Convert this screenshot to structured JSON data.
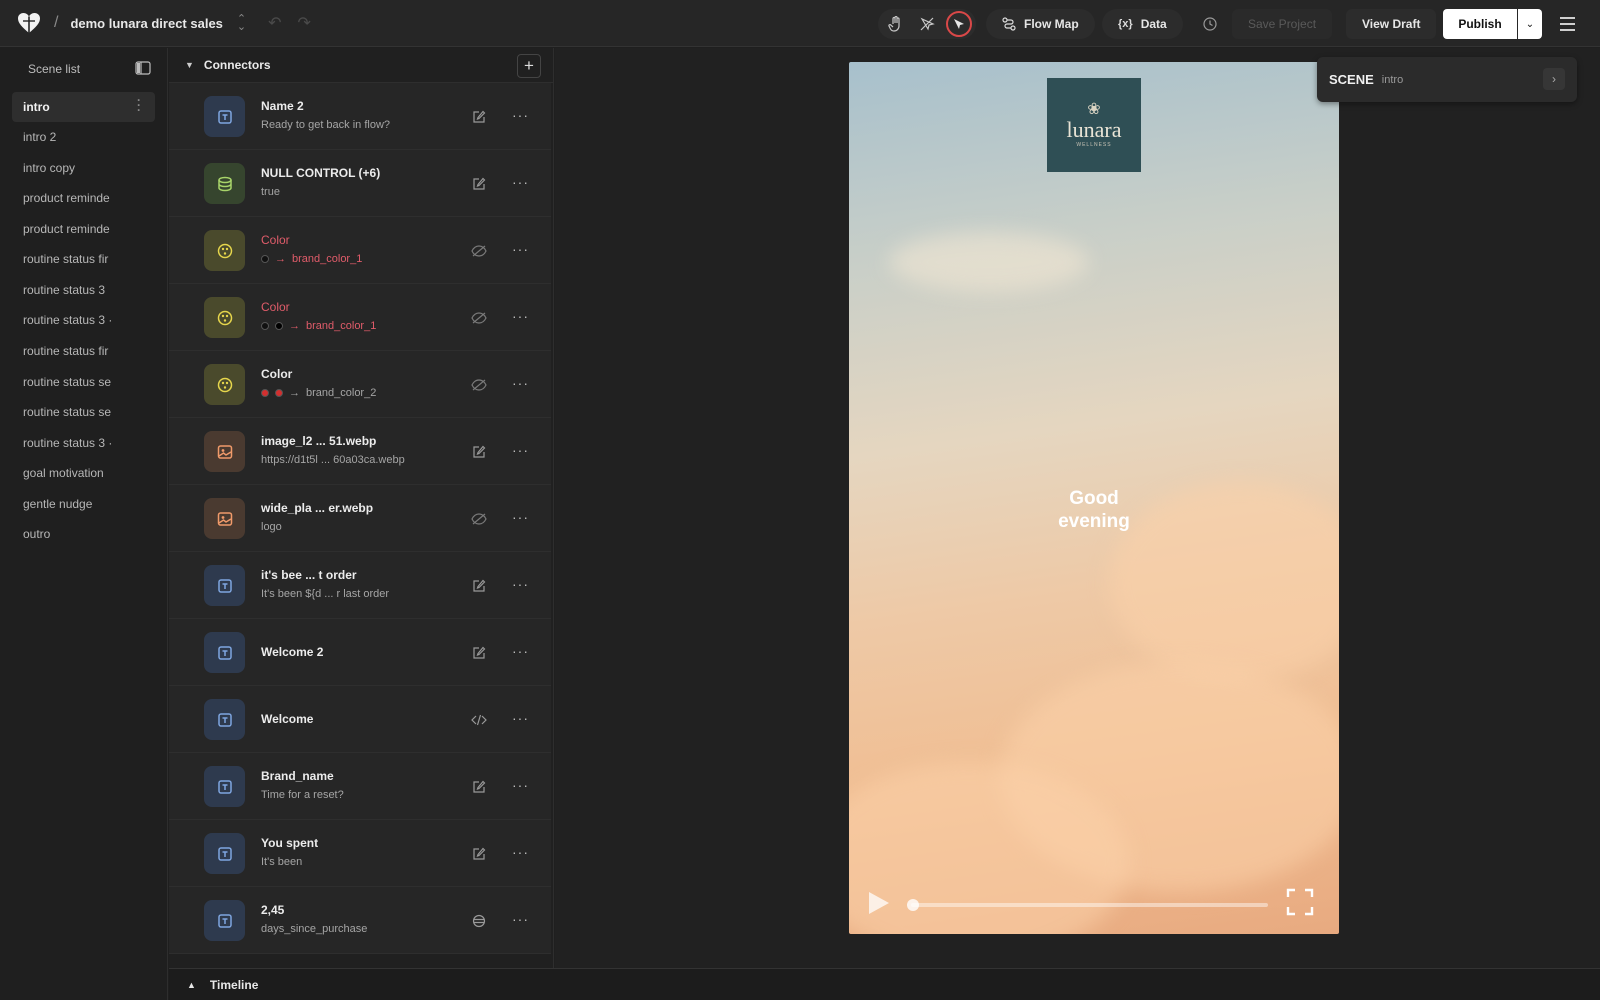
{
  "topbar": {
    "project_name": "demo lunara direct sales",
    "flow_map_label": "Flow Map",
    "data_label": "Data",
    "save_label": "Save Project",
    "view_draft_label": "View Draft",
    "publish_label": "Publish"
  },
  "scene_list": {
    "title": "Scene list",
    "items": [
      {
        "label": "intro",
        "active": true
      },
      {
        "label": "intro 2"
      },
      {
        "label": "intro copy"
      },
      {
        "label": "product reminde"
      },
      {
        "label": "product reminde"
      },
      {
        "label": "routine status fir"
      },
      {
        "label": "routine status 3"
      },
      {
        "label": "routine status 3 ·"
      },
      {
        "label": "routine status fir"
      },
      {
        "label": "routine status se"
      },
      {
        "label": "routine status se"
      },
      {
        "label": "routine status 3 ·"
      },
      {
        "label": "goal motivation"
      },
      {
        "label": "gentle nudge"
      },
      {
        "label": "outro"
      }
    ]
  },
  "connectors": {
    "title": "Connectors",
    "rows": [
      {
        "title": "Name 2",
        "subtitle": "Ready to get back in flow?",
        "icon": "text-connector-icon",
        "action": "edit-icon"
      },
      {
        "title": "NULL CONTROL (+6)",
        "subtitle": "true",
        "icon": "database-icon",
        "action": "edit-icon"
      },
      {
        "title": "Color",
        "subtitle": "brand_color_1",
        "icon": "palette-icon",
        "action": "hidden-icon",
        "red": true
      },
      {
        "title": "Color",
        "subtitle": "brand_color_1",
        "icon": "palette-icon",
        "action": "hidden-icon",
        "red": true
      },
      {
        "title": "Color",
        "subtitle": "brand_color_2",
        "icon": "palette-icon",
        "action": "hidden-icon"
      },
      {
        "title": "image_l2 ... 51.webp",
        "subtitle": "https://d1t5l ... 60a03ca.webp",
        "icon": "image-icon",
        "action": "edit-icon"
      },
      {
        "title": "wide_pla ... er.webp",
        "subtitle": "logo",
        "icon": "image-icon",
        "action": "hidden-icon"
      },
      {
        "title": "it's bee ... t order",
        "subtitle": "It's been ${d ... r last order",
        "icon": "text-connector-icon",
        "action": "edit-icon"
      },
      {
        "title": "Welcome 2",
        "subtitle": "",
        "icon": "text-connector-icon",
        "action": "edit-icon"
      },
      {
        "title": "Welcome",
        "subtitle": "",
        "icon": "text-connector-icon",
        "action": "code-icon"
      },
      {
        "title": "Brand_name",
        "subtitle": "Time for a reset?",
        "icon": "text-connector-icon",
        "action": "edit-icon"
      },
      {
        "title": "You spent",
        "subtitle": "It's been",
        "icon": "text-connector-icon",
        "action": "edit-icon"
      },
      {
        "title": "2,45",
        "subtitle": "days_since_purchase",
        "icon": "text-connector-icon",
        "action": "database-icon"
      }
    ]
  },
  "preview": {
    "brand_word": "lunara",
    "brand_sub": "WELLNESS",
    "greeting": "Good evening"
  },
  "scene_card": {
    "label": "SCENE",
    "value": "intro"
  },
  "timeline": {
    "label": "Timeline"
  },
  "colors": {
    "accent_red": "#e05c6a",
    "logo_bg": "#2f4f55",
    "publish_bg": "#ffffff"
  }
}
